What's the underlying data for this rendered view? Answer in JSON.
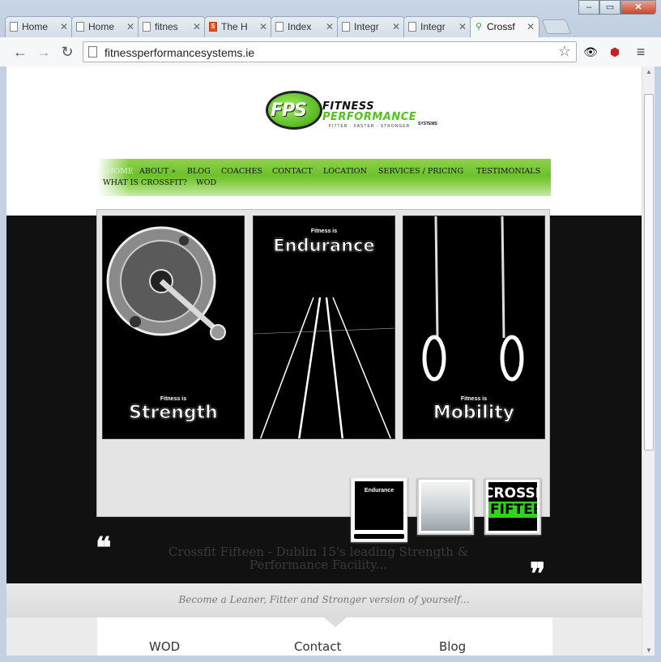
{
  "browser": {
    "tabs": [
      {
        "label": "Home",
        "icon": "page-icon"
      },
      {
        "label": "Home",
        "icon": "page-icon"
      },
      {
        "label": "fitnes",
        "icon": "page-icon"
      },
      {
        "label": "The H",
        "icon": "html5-icon"
      },
      {
        "label": "Index",
        "icon": "page-icon"
      },
      {
        "label": "Integr",
        "icon": "page-icon"
      },
      {
        "label": "Integr",
        "icon": "page-icon"
      },
      {
        "label": "Crossf",
        "icon": "crossfit-icon"
      }
    ],
    "url": "fitnessperformancesystems.ie",
    "accent_green": "#6cc12c"
  },
  "site": {
    "logo": {
      "mark": "FPS",
      "word1": "FITNESS",
      "word2": "PERFORMANCE",
      "tagline": "FITTER · FASTER · STRONGER",
      "sub": "SYSTEMS"
    },
    "nav": {
      "home": "HOME",
      "about": "ABOUT »",
      "blog": "BLOG",
      "coaches": "COACHES",
      "contact": "CONTACT",
      "location": "LOCATION",
      "services": "SERVICES / PRICING",
      "testimonials": "TESTIMONIALS",
      "what_is_crossfit": "WHAT IS CROSSFIT?",
      "wod": "WOD"
    },
    "slides": [
      {
        "top": "Fitness is",
        "word": "Strength"
      },
      {
        "top": "Fitness is",
        "word": "Endurance"
      },
      {
        "top": "Fitness is",
        "word": "Mobility"
      }
    ],
    "thumbs": {
      "t1_word": "Endurance",
      "t3_line1": "CROSSFI",
      "t3_line2": "FIFTEEN"
    },
    "tagline": "Crossfit Fifteen - Dublin 15's leading Strength & Performance Facility...",
    "strap": "Become a Leaner, Fitter and Stronger version of yourself...",
    "footer": {
      "wod": "WOD",
      "contact": "Contact",
      "blog": "Blog"
    }
  }
}
